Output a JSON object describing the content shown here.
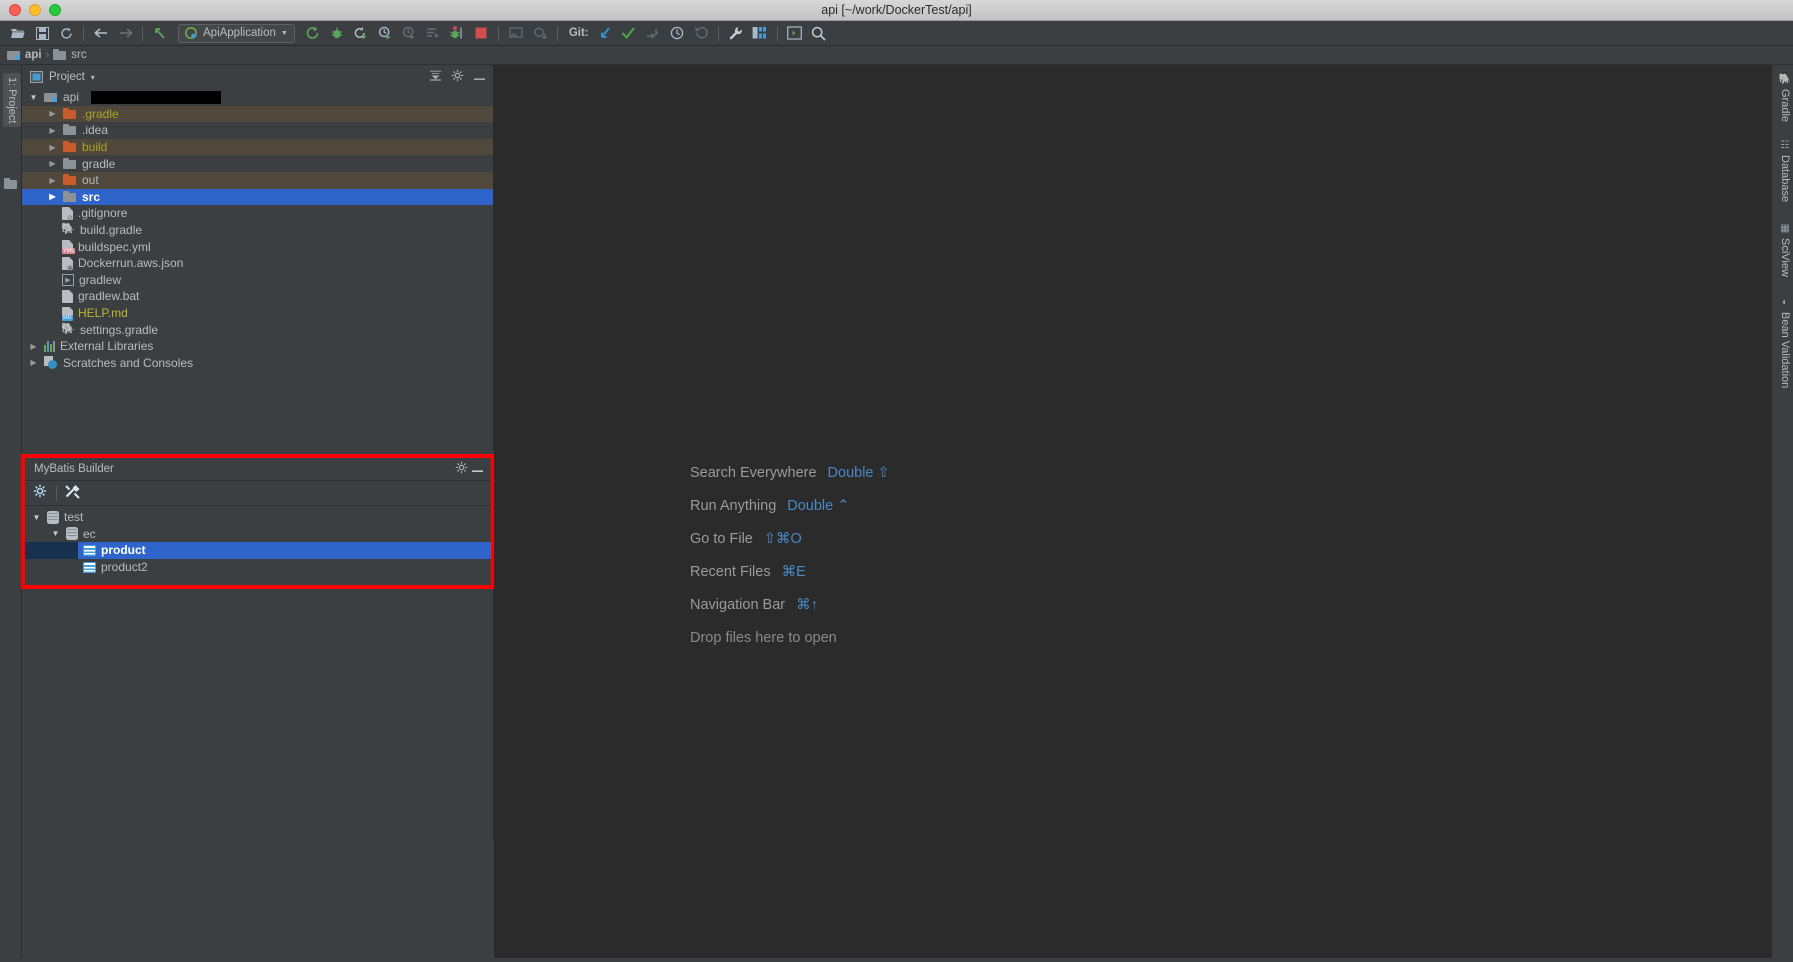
{
  "window": {
    "title": "api [~/work/DockerTest/api]",
    "traffic_lights": [
      "close-red",
      "minimize-yellow",
      "maximize-green"
    ]
  },
  "toolbar": {
    "icons": [
      {
        "name": "open-project-icon",
        "glyph": "⬚",
        "kind": "folder"
      },
      {
        "name": "save-all-icon",
        "glyph": "Ὃe",
        "kind": "save"
      },
      {
        "name": "sync-icon",
        "glyph": "⟳",
        "kind": "sync"
      },
      {
        "name": "back-icon",
        "glyph": "←",
        "kind": "arrow"
      },
      {
        "name": "forward-icon",
        "glyph": "→",
        "kind": "arrow-dim"
      },
      {
        "name": "last-edit-location-icon",
        "glyph": "↖",
        "kind": "green-arrow"
      }
    ],
    "run_configuration": {
      "label": "ApiApplication",
      "chevron": "▼"
    },
    "run_icons": [
      {
        "name": "run-icon",
        "glyph": "↷"
      },
      {
        "name": "debug-icon",
        "glyph": "🐞"
      },
      {
        "name": "run-with-coverage-icon",
        "glyph": "▶"
      },
      {
        "name": "profile-icon",
        "glyph": "◴"
      },
      {
        "name": "attach-profiler-icon",
        "glyph": "◴"
      },
      {
        "name": "run-dashboard-icon",
        "glyph": "≡"
      },
      {
        "name": "rerun-tests-icon",
        "glyph": "🐞"
      },
      {
        "name": "stop-icon",
        "glyph": "■"
      }
    ],
    "deploy_icons": [
      {
        "name": "build-icon",
        "glyph": "⬚"
      },
      {
        "name": "update-app-icon",
        "glyph": "⬇"
      }
    ],
    "git_label": "Git:",
    "git_icons": [
      {
        "name": "update-project-icon",
        "glyph": "↙"
      },
      {
        "name": "commit-icon",
        "glyph": "✓"
      },
      {
        "name": "push-icon",
        "glyph": "⤴"
      },
      {
        "name": "history-icon",
        "glyph": "◷"
      },
      {
        "name": "rollback-icon",
        "glyph": "↺"
      }
    ],
    "right_icons": [
      {
        "name": "settings-wrench-icon",
        "glyph": "🔧"
      },
      {
        "name": "project-structure-icon",
        "glyph": "☰"
      },
      {
        "name": "terminal-icon",
        "glyph": "▷"
      },
      {
        "name": "search-icon",
        "glyph": "🔍"
      }
    ]
  },
  "breadcrumb": {
    "items": [
      {
        "label": "api",
        "icon": "folder-root-icon"
      },
      {
        "label": "src",
        "icon": "folder-icon"
      }
    ],
    "separator": "›"
  },
  "left_strip": {
    "tabs": [
      {
        "label": "1: Project",
        "icon": "project-icon",
        "active": true
      }
    ],
    "bottom_icon": "folder-icon"
  },
  "right_strip": {
    "tabs": [
      {
        "label": "Gradle",
        "icon": "gradle-icon"
      },
      {
        "label": "Database",
        "icon": "database-icon"
      },
      {
        "label": "SciView",
        "icon": "sciview-icon"
      },
      {
        "label": "Bean Validation",
        "icon": "bean-validation-icon"
      }
    ]
  },
  "project_panel": {
    "title": "Project",
    "title_chevron": "▾",
    "view_icon": "project-view-icon",
    "header_icons": [
      {
        "name": "collapse-all-icon",
        "glyph": "⤓"
      },
      {
        "name": "settings-gear-icon",
        "glyph": "⚙"
      },
      {
        "name": "hide-panel-icon",
        "glyph": "—"
      }
    ],
    "tree": [
      {
        "label": "api",
        "indent": 0,
        "arrow": "open",
        "icon": "folder-root",
        "selected": false,
        "redacted": true
      },
      {
        "label": ".gradle",
        "indent": 1,
        "arrow": "closed",
        "icon": "folder-orange",
        "excluded": true,
        "color": "olive"
      },
      {
        "label": ".idea",
        "indent": 1,
        "arrow": "closed",
        "icon": "folder-blue",
        "excluded": false
      },
      {
        "label": "build",
        "indent": 1,
        "arrow": "closed",
        "icon": "folder-orange",
        "excluded": true,
        "color": "olive"
      },
      {
        "label": "gradle",
        "indent": 1,
        "arrow": "closed",
        "icon": "folder-blue",
        "excluded": false
      },
      {
        "label": "out",
        "indent": 1,
        "arrow": "closed",
        "icon": "folder-orange",
        "excluded": true
      },
      {
        "label": "src",
        "indent": 1,
        "arrow": "closed",
        "icon": "folder-blue",
        "selected": true
      },
      {
        "label": ".gitignore",
        "indent": 2,
        "arrow": "none",
        "icon": "file-gitignore"
      },
      {
        "label": "build.gradle",
        "indent": 2,
        "arrow": "none",
        "icon": "file-gradle"
      },
      {
        "label": "buildspec.yml",
        "indent": 2,
        "arrow": "none",
        "icon": "file-yml"
      },
      {
        "label": "Dockerrun.aws.json",
        "indent": 2,
        "arrow": "none",
        "icon": "file-json"
      },
      {
        "label": "gradlew",
        "indent": 2,
        "arrow": "none",
        "icon": "file-script"
      },
      {
        "label": "gradlew.bat",
        "indent": 2,
        "arrow": "none",
        "icon": "file-bat"
      },
      {
        "label": "HELP.md",
        "indent": 2,
        "arrow": "none",
        "icon": "file-md",
        "color": "yellow"
      },
      {
        "label": "settings.gradle",
        "indent": 2,
        "arrow": "none",
        "icon": "file-gradle"
      },
      {
        "label": "External Libraries",
        "indent": 0,
        "arrow": "closed",
        "icon": "libraries"
      },
      {
        "label": "Scratches and Consoles",
        "indent": 0,
        "arrow": "closed",
        "icon": "scratches"
      }
    ]
  },
  "mybatis_panel": {
    "title": "MyBatis Builder",
    "highlight_color": "#ff0000",
    "header_icons": [
      {
        "name": "settings-gear-icon",
        "glyph": "⚙"
      },
      {
        "name": "hide-panel-icon",
        "glyph": "—"
      }
    ],
    "toolbar_icons": [
      {
        "name": "mybatis-settings-icon",
        "glyph": "⚙"
      },
      {
        "name": "mybatis-generate-icon",
        "glyph": "⚒"
      }
    ],
    "tree": [
      {
        "label": "test",
        "indent": 0,
        "arrow": "open",
        "icon": "database",
        "selected": false
      },
      {
        "label": "ec",
        "indent": 1,
        "arrow": "open",
        "icon": "schema",
        "selected": false
      },
      {
        "label": "product",
        "indent": 2,
        "arrow": "none",
        "icon": "table",
        "selected": true
      },
      {
        "label": "product2",
        "indent": 2,
        "arrow": "none",
        "icon": "table",
        "selected": false
      }
    ]
  },
  "welcome": {
    "rows": [
      {
        "label": "Search Everywhere",
        "shortcut": "Double ⇧"
      },
      {
        "label": "Run Anything",
        "shortcut": "Double ⌃"
      },
      {
        "label": "Go to File",
        "shortcut": "⇧⌘O"
      },
      {
        "label": "Recent Files",
        "shortcut": "⌘E"
      },
      {
        "label": "Navigation Bar",
        "shortcut": "⌘↑"
      }
    ],
    "drop_hint": "Drop files here to open"
  },
  "colors": {
    "accent_selection": "#2f65ca",
    "excluded_bg": "#50483a",
    "panel_bg": "#3c3f41",
    "editor_bg": "#2b2b2b",
    "link_blue": "#4a88c7",
    "highlight_red": "#ff0000"
  }
}
